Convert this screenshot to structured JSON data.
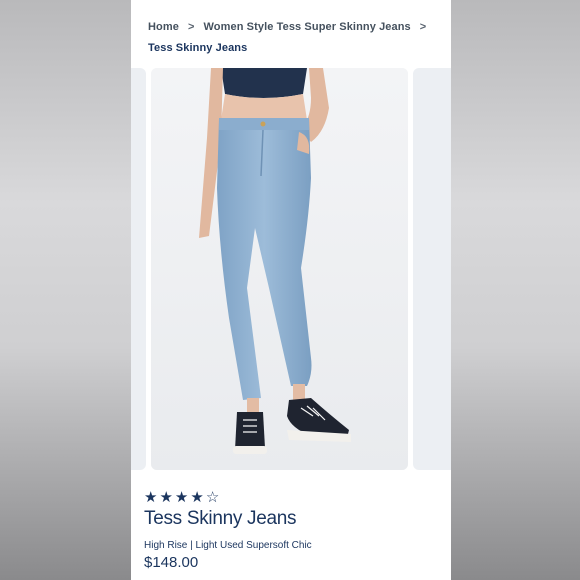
{
  "breadcrumb": {
    "items": [
      "Home",
      "Women Style Tess Super Skinny Jeans"
    ],
    "separator": ">",
    "current": "Tess Skinny Jeans"
  },
  "product": {
    "title": "Tess Skinny Jeans",
    "subtitle": "High Rise | Light Used Supersoft Chic",
    "price": "$148.00",
    "rating": {
      "value": 4,
      "max": 5
    }
  },
  "colors": {
    "brand_navy": "#1b355e",
    "denim": "#8fb0cf",
    "top": "#22324d"
  },
  "images": {
    "main": "model wearing light blue skinny jeans with navy crop top and black high-top sneakers"
  }
}
